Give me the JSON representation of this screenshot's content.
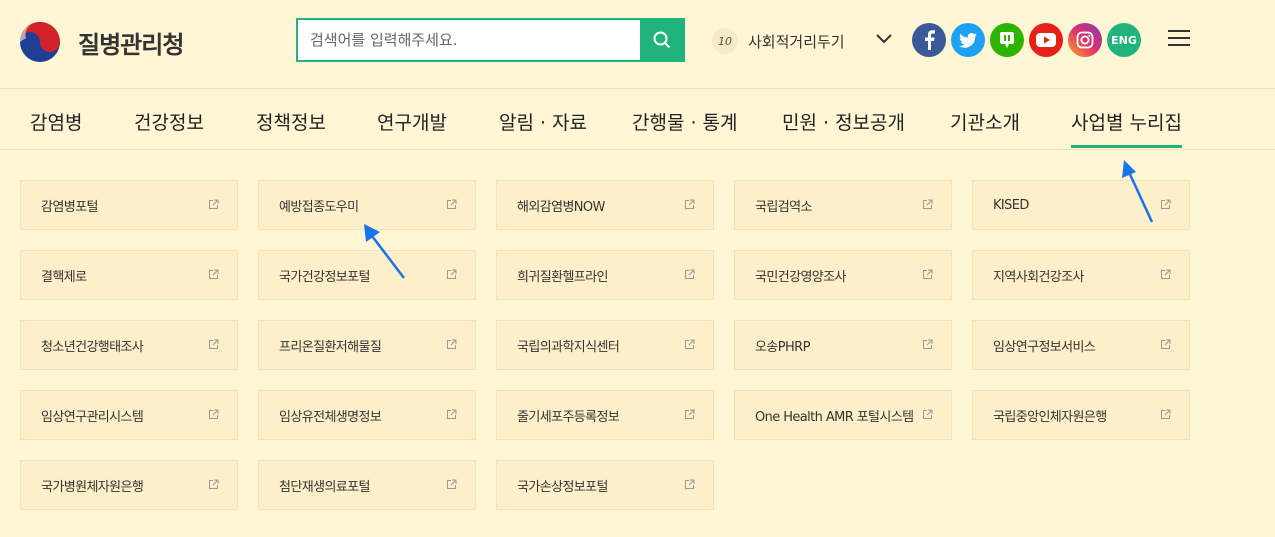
{
  "header": {
    "logo_text": "질병관리청",
    "search_placeholder": "검색어를 입력해주세요.",
    "distancing_level": "10",
    "distancing_label": "사회적거리두기",
    "social": [
      "facebook-icon",
      "twitter-icon",
      "blog-icon",
      "youtube-icon",
      "instagram-icon"
    ],
    "eng_label": "ENG"
  },
  "nav": [
    "감염병",
    "건강정보",
    "정책정보",
    "연구개발",
    "알림 · 자료",
    "간행물 · 통계",
    "민원 · 정보공개",
    "기관소개",
    "사업별 누리집"
  ],
  "active_nav": "사업별 누리집",
  "sites": [
    "감염병포털",
    "예방접종도우미",
    "해외감염병NOW",
    "국립검역소",
    "KISED",
    "결핵제로",
    "국가건강정보포털",
    "희귀질환헬프라인",
    "국민건강영양조사",
    "지역사회건강조사",
    "청소년건강행태조사",
    "프리온질환저해물질",
    "국립의과학지식센터",
    "오송PHRP",
    "임상연구정보서비스",
    "임상연구관리시스템",
    "임상유전체생명정보",
    "줄기세포주등록정보",
    "One Health AMR 포털시스템",
    "국립중앙인체자원은행",
    "국가병원체자원은행",
    "첨단재생의료포털",
    "국가손상정보포털"
  ],
  "colors": {
    "background": "#fef6d4",
    "accent": "#21b37e",
    "tile": "#fdefc9",
    "arrow": "#1a73e8"
  }
}
